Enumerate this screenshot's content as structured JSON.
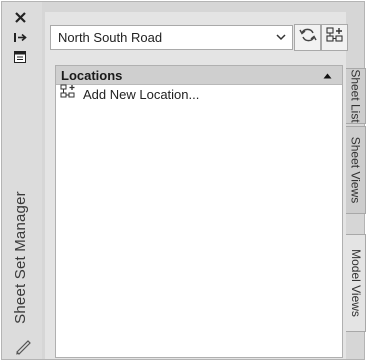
{
  "palette": {
    "title": "Sheet Set Manager"
  },
  "toolbar": {
    "sheet_set_name": "North South Road"
  },
  "tree": {
    "header": "Locations",
    "items": [
      {
        "label": "Add New Location..."
      }
    ]
  },
  "tabs": [
    {
      "label": "Sheet List",
      "active": false
    },
    {
      "label": "Sheet Views",
      "active": false
    },
    {
      "label": "Model Views",
      "active": true
    }
  ],
  "icons": {
    "close": "close-icon",
    "autohide": "autohide-icon",
    "properties": "properties-icon",
    "refresh": "refresh-icon",
    "add_location": "add-location-icon",
    "resize": "resize-grip-icon"
  }
}
